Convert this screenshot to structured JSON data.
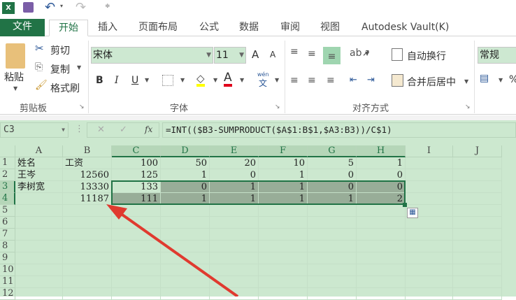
{
  "qat": {
    "icons": [
      "excel-icon",
      "save-icon",
      "undo-icon",
      "redo-icon",
      "customize-icon"
    ]
  },
  "tabs": [
    "文件",
    "开始",
    "插入",
    "页面布局",
    "公式",
    "数据",
    "审阅",
    "视图",
    "Autodesk Vault(K)"
  ],
  "clipboard": {
    "paste": "粘贴",
    "cut": "剪切",
    "copy": "复制",
    "format_painter": "格式刷",
    "label": "剪贴板"
  },
  "font": {
    "name": "宋体",
    "size": "11",
    "bold": "B",
    "italic": "I",
    "underline": "U",
    "label": "字体",
    "grow": "A",
    "shrink": "A",
    "phonetic": "wén"
  },
  "alignment": {
    "wrap": "自动换行",
    "merge": "合并后居中",
    "label": "对齐方式"
  },
  "number": {
    "format": "常规",
    "percent": "%"
  },
  "formula_bar": {
    "name_box": "C3",
    "fx": "fx",
    "formula": "=INT(($B3-SUMPRODUCT($A$1:B$1,$A3:B3))/C$1)"
  },
  "columns": [
    "A",
    "B",
    "C",
    "D",
    "E",
    "F",
    "G",
    "H",
    "I",
    "J"
  ],
  "rows": [
    [
      "姓名",
      "工资",
      "100",
      "50",
      "20",
      "10",
      "5",
      "1"
    ],
    [
      "王岑",
      "12560",
      "125",
      "1",
      "0",
      "1",
      "0",
      "0"
    ],
    [
      "李树宽",
      "13330",
      "133",
      "0",
      "1",
      "1",
      "0",
      "0"
    ],
    [
      "",
      "11187",
      "111",
      "1",
      "1",
      "1",
      "1",
      "2"
    ]
  ],
  "row_numbers": [
    "1",
    "2",
    "3",
    "4",
    "5",
    "6",
    "7",
    "8",
    "9",
    "10",
    "11",
    "12"
  ],
  "colors": {
    "accent": "#217346",
    "sheet_bg": "#cce8cf",
    "arrow": "#e03a2f"
  }
}
